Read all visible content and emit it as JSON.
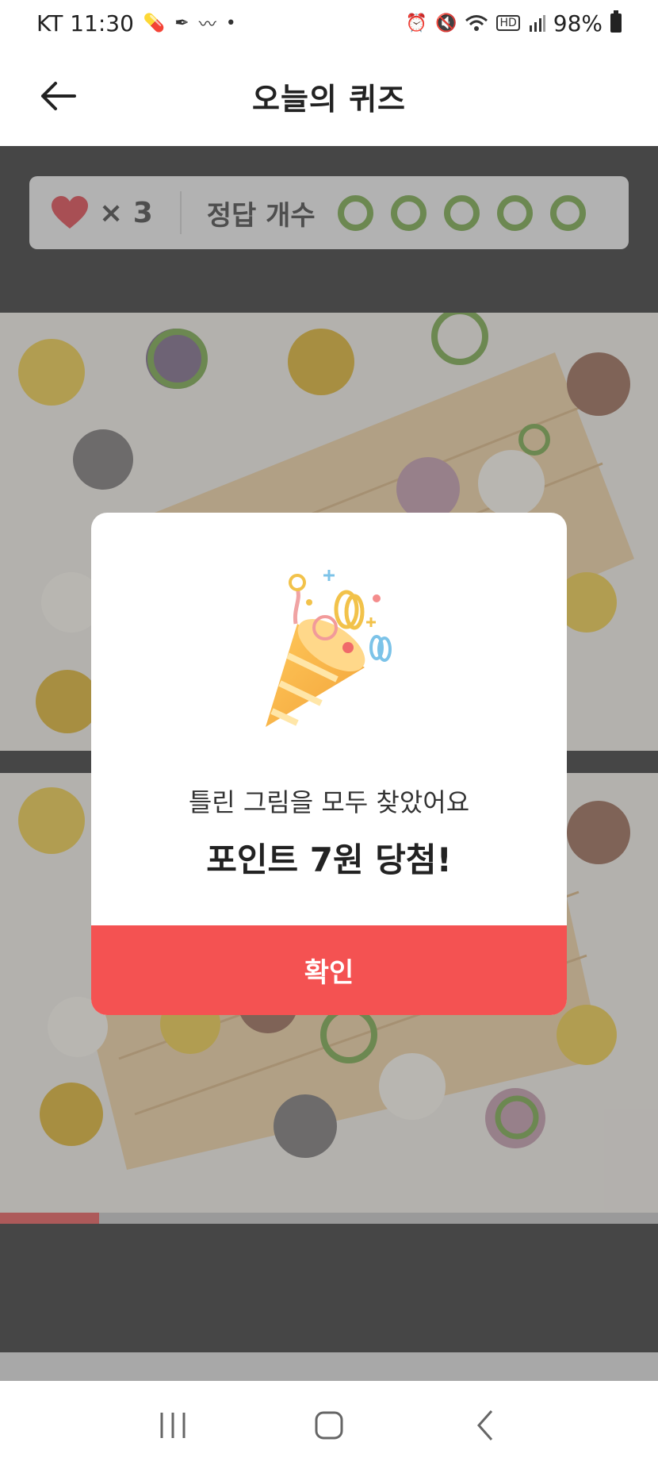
{
  "status_bar": {
    "carrier_time": "KT 11:30",
    "battery": "98%",
    "icons": [
      "pill-icon",
      "feather-icon",
      "mustache-icon",
      "dot-icon",
      "alarm-icon",
      "mute-icon",
      "wifi-icon",
      "hd-icon",
      "signal-icon",
      "battery-icon"
    ]
  },
  "header": {
    "title": "오늘의 퀴즈",
    "back_icon": "arrow-left-icon"
  },
  "score_bar": {
    "lives_label": "× 3",
    "answers_label": "정답 개수",
    "answers_found": 5,
    "answers_total": 5,
    "circle_color": "#6a9d3a"
  },
  "progress": {
    "fraction": 0.15,
    "color": "#e04a4a"
  },
  "modal": {
    "message": "틀린 그림을 모두 찾았어요",
    "reward": "포인트 7원 당첨!",
    "confirm_label": "확인",
    "confirm_color": "#f45252",
    "icon": "party-popper-icon"
  },
  "nav": {
    "recent_icon": "recent-apps-icon",
    "home_icon": "home-icon",
    "back_icon": "back-chevron-icon"
  }
}
